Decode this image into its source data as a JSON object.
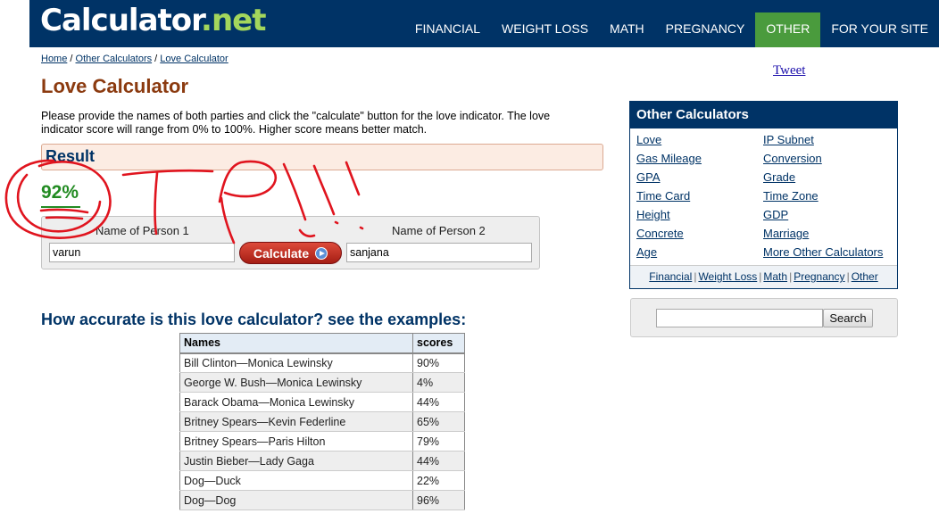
{
  "header": {
    "logo_main": "Calculator",
    "logo_ext": ".net",
    "nav": [
      "FINANCIAL",
      "WEIGHT LOSS",
      "MATH",
      "PREGNANCY",
      "OTHER",
      "FOR YOUR SITE"
    ]
  },
  "breadcrumb": {
    "home": "Home",
    "sep": " / ",
    "other": "Other Calculators",
    "current": "Love Calculator"
  },
  "page_title": "Love Calculator",
  "intro": "Please provide the names of both parties and click the \"calculate\" button for the love indicator. The love indicator score will range from 0% to 100%. Higher score means better match.",
  "result": {
    "label": "Result",
    "score": "92%"
  },
  "form": {
    "person1_label": "Name of Person 1",
    "person1_value": "varun",
    "person2_label": "Name of Person 2",
    "person2_value": "sanjana",
    "calculate_label": "Calculate"
  },
  "examples": {
    "heading": "How accurate is this love calculator? see the examples:",
    "columns": [
      "Names",
      "scores"
    ],
    "rows": [
      [
        "Bill Clinton—Monica Lewinsky",
        "90%"
      ],
      [
        "George W. Bush—Monica Lewinsky",
        "4%"
      ],
      [
        "Barack Obama—Monica Lewinsky",
        "44%"
      ],
      [
        "Britney Spears—Kevin Federline",
        "65%"
      ],
      [
        "Britney Spears—Paris Hilton",
        "79%"
      ],
      [
        "Justin Bieber—Lady Gaga",
        "44%"
      ],
      [
        "Dog—Duck",
        "22%"
      ],
      [
        "Dog—Dog",
        "96%"
      ]
    ]
  },
  "sidebar": {
    "tweet": "Tweet",
    "other_title": "Other Calculators",
    "links_left": [
      "Love",
      "Gas Mileage",
      "GPA",
      "Time Card",
      "Height",
      "Concrete",
      "Age"
    ],
    "links_right": [
      "IP Subnet",
      "Conversion",
      "Grade",
      "Time Zone",
      "GDP",
      "Marriage",
      "More Other Calculators"
    ],
    "footer_links": [
      "Financial",
      "Weight Loss",
      "Math",
      "Pregnancy",
      "Other"
    ],
    "search_button": "Search"
  },
  "colors": {
    "header_bg": "#003366",
    "active_nav": "#4a9b3d",
    "title": "#8b3a0f",
    "score": "#228b22",
    "scribble": "#e0141e"
  }
}
